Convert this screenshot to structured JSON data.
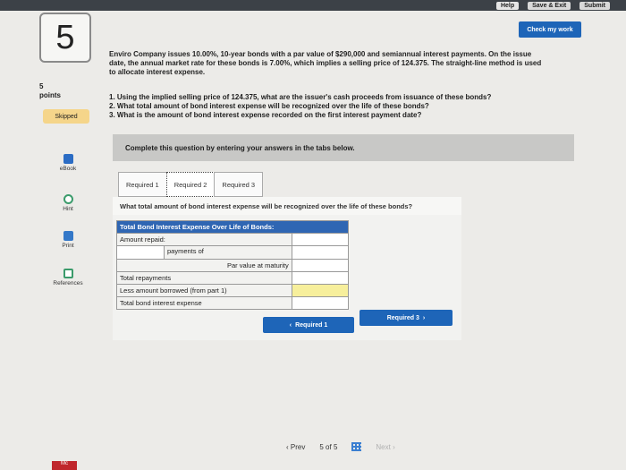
{
  "header": {
    "help_label": "Help",
    "save_exit_label": "Save & Exit",
    "submit_label": "Submit"
  },
  "question": {
    "number": "5",
    "points_value": "5",
    "points_label": "points",
    "status": "Skipped",
    "check_label": "Check my work"
  },
  "sidebar": {
    "ebook": "eBook",
    "hint": "Hint",
    "print": "Print",
    "references": "References"
  },
  "problem": {
    "line1": "Enviro Company issues 10.00%, 10-year bonds with a par value of $290,000 and semiannual interest payments. On the issue",
    "line2": "date, the annual market rate for these bonds is 7.00%, which implies a selling price of 124.375. The straight-line method is used",
    "line3": "to allocate interest expense.",
    "req1": "1. Using the implied selling price of 124.375, what are the issuer's cash proceeds from issuance of these bonds?",
    "req2": "2. What total amount of bond interest expense will be recognized over the life of these bonds?",
    "req3": "3. What is the amount of bond interest expense recorded on the first interest payment date?"
  },
  "instruction": "Complete this question by entering your answers in the tabs below.",
  "tabs": [
    {
      "label": "Required 1"
    },
    {
      "label": "Required 2"
    },
    {
      "label": "Required 3"
    }
  ],
  "tab_question": "What total amount of bond interest expense will be recognized over the life of these bonds?",
  "table": {
    "header": "Total Bond Interest Expense Over Life of Bonds:",
    "amount_repaid": "Amount repaid:",
    "payments_of": "payments of",
    "par_value": "Par value at maturity",
    "total_repayments": "Total repayments",
    "less_borrowed": "Less amount borrowed (from part 1)",
    "total_expense": "Total bond interest expense"
  },
  "nav": {
    "prev_req": "Required 1",
    "next_req": "Required 3",
    "prev": "Prev",
    "page_current": "5",
    "page_of": "of",
    "page_total": "5",
    "next": "Next"
  },
  "brand": "Mc",
  "colors": {
    "primary": "#1e65b8",
    "table_header": "#2f66b3",
    "skipped": "#f5d58a",
    "highlight": "#f7ef9c"
  }
}
